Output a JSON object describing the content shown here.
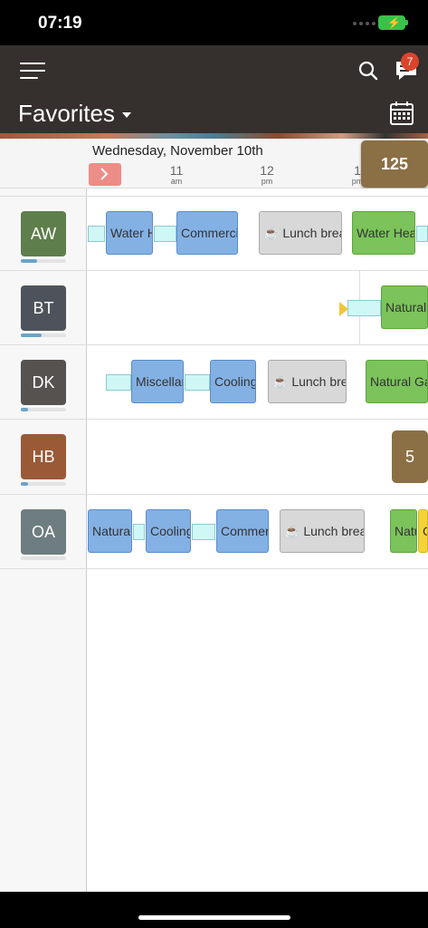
{
  "status": {
    "time": "07:19"
  },
  "header": {
    "title": "Favorites",
    "notification_count": "7"
  },
  "timeline": {
    "date": "Wednesday, November 10th",
    "hours": [
      {
        "num": "11",
        "ampm": "am"
      },
      {
        "num": "12",
        "ampm": "pm"
      },
      {
        "num": "1",
        "ampm": "pm"
      }
    ],
    "unassigned_count": "125"
  },
  "rows": [
    {
      "initials": "AW",
      "avatar_color": "#5e7e4c",
      "progress": 0.35,
      "tasks": [
        "Water Heater",
        "Commercial",
        "☕ Lunch break",
        "Water Heater"
      ]
    },
    {
      "initials": "BT",
      "avatar_color": "#4e535b",
      "progress": 0.45,
      "tasks": [
        "Natural Gas"
      ]
    },
    {
      "initials": "DK",
      "avatar_color": "#55524f",
      "progress": 0.15,
      "tasks": [
        "Miscellaneous",
        "Cooling",
        "☕ Lunch break",
        "Natural Gas"
      ]
    },
    {
      "initials": "HB",
      "avatar_color": "#9a5a38",
      "progress": 0.15,
      "tasks": [],
      "count": "5"
    },
    {
      "initials": "OA",
      "avatar_color": "#6e7d80",
      "progress": 0,
      "tasks": [
        "Natural Gas",
        "Cooling",
        "Commercial",
        "☕ Lunch break",
        "Natural Gas",
        "Cooling"
      ]
    }
  ]
}
